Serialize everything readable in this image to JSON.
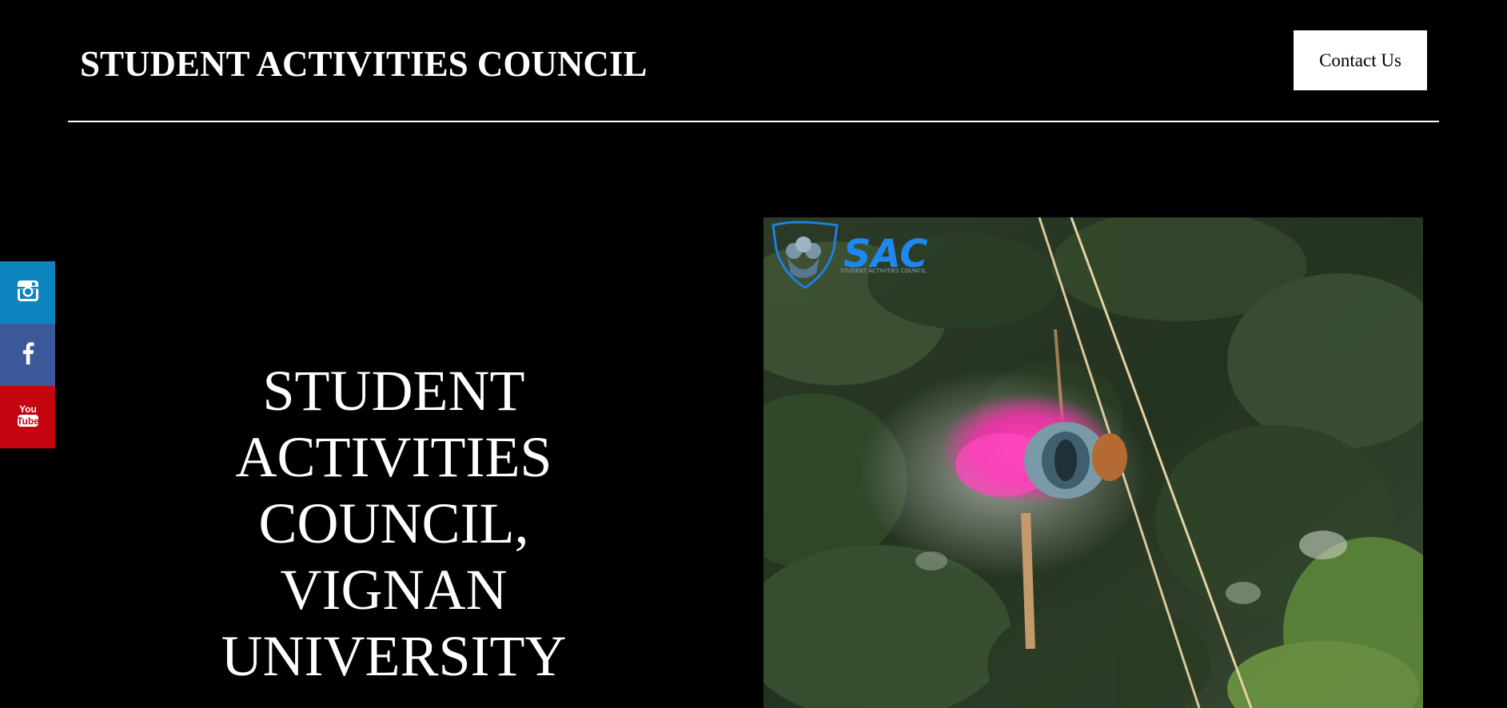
{
  "header": {
    "title": "STUDENT ACTIVITIES COUNCIL",
    "contact_label": "Contact Us"
  },
  "social": {
    "items": [
      {
        "name": "instagram",
        "icon": "instagram-icon",
        "color": "#0d83bf"
      },
      {
        "name": "facebook",
        "icon": "facebook-icon",
        "color": "#3b5998"
      },
      {
        "name": "youtube",
        "icon": "youtube-icon",
        "color": "#c4040f"
      }
    ]
  },
  "hero": {
    "heading_lines": [
      "STUDENT",
      "ACTIVITIES",
      "COUNCIL,",
      "VIGNAN",
      "UNIVERSITY"
    ],
    "logo_text": "SAC",
    "logo_subtext": "STUDENT ACTIVITIES COUNCIL"
  }
}
